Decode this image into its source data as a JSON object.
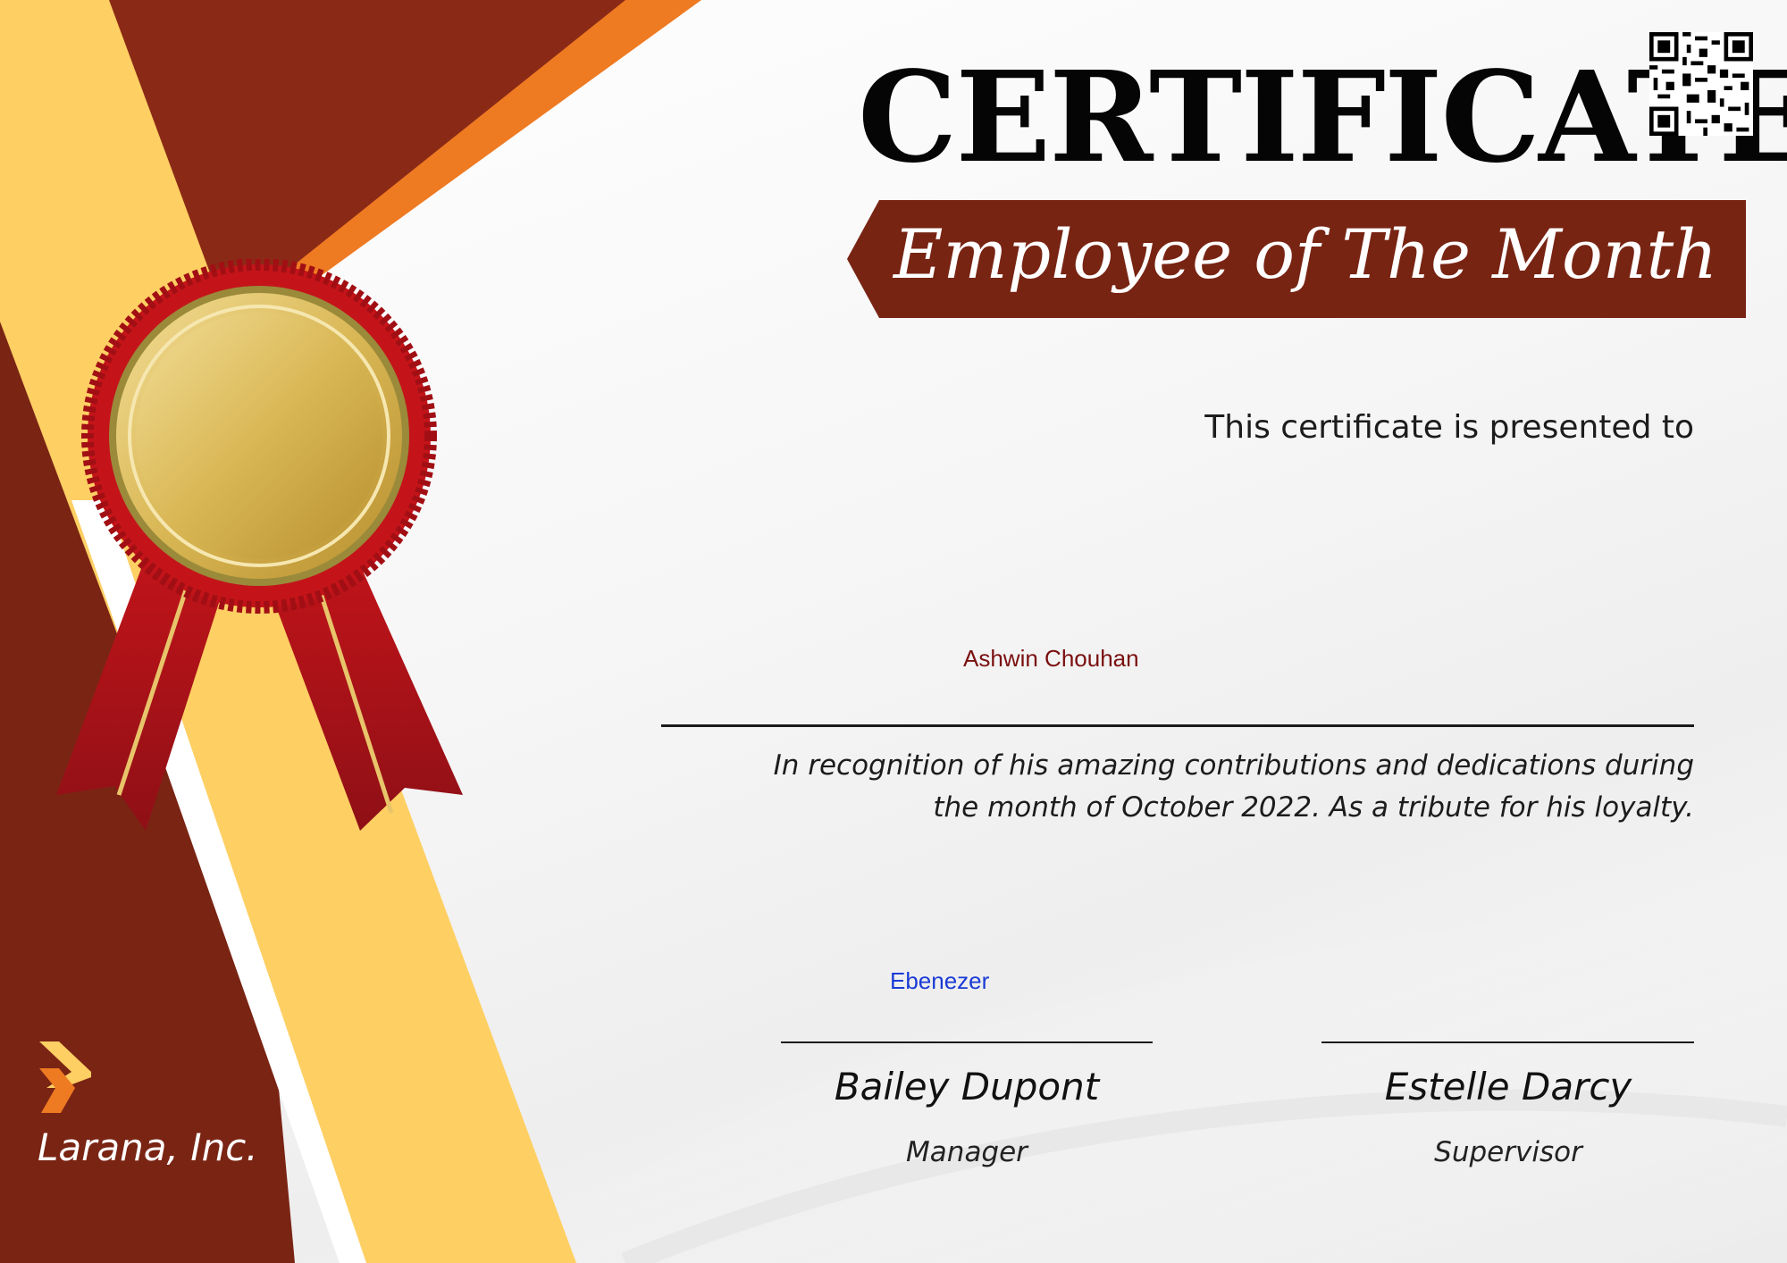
{
  "certificate": {
    "title": "CERTIFICATE",
    "subtitle": "Employee of The Month",
    "presented_text": "This certificate is presented to",
    "recipient_name": "Ashwin Chouhan",
    "recognition_line_1": "In recognition of his amazing contributions and dedications during",
    "recognition_line_2": "the month of October 2022. As a tribute for his loyalty.",
    "signature_text": "Ebenezer"
  },
  "signers": [
    {
      "name": "Bailey Dupont",
      "title": "Manager"
    },
    {
      "name": "Estelle Darcy",
      "title": "Supervisor"
    }
  ],
  "company": {
    "name": "Larana, Inc."
  },
  "icons": {
    "qr": "qr-code-icon",
    "medal": "gold-medal-ribbon-icon",
    "logo": "chevron-logo-icon"
  },
  "colors": {
    "maroon": "#7a2414",
    "orange": "#ee7a22",
    "yellow": "#fecf63",
    "recipient_red": "#7a1010",
    "signature_blue": "#1a3bd6"
  }
}
